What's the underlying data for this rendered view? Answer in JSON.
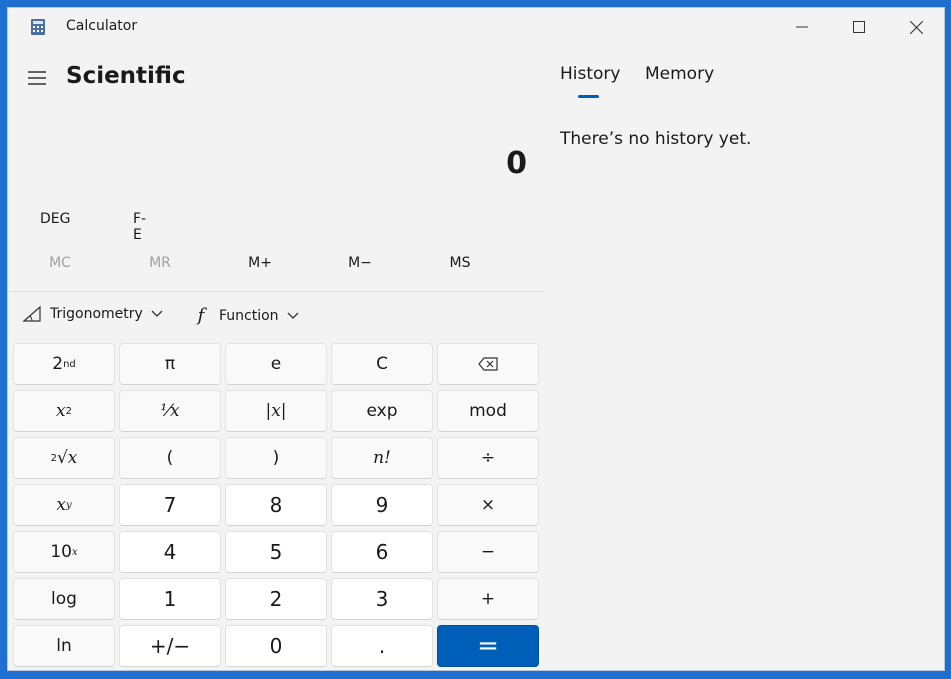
{
  "window": {
    "title": "Calculator",
    "icons": {
      "app": "calculator-icon",
      "minimize": "minimize-icon",
      "maximize": "maximize-icon",
      "close": "close-icon"
    }
  },
  "header": {
    "mode_title": "Scientific",
    "menu_icon": "hamburger-icon"
  },
  "display": {
    "value": "0"
  },
  "modes": {
    "angle": "DEG",
    "notation": "F-E"
  },
  "memory_row": {
    "mc": "MC",
    "mr": "MR",
    "m_plus": "M+",
    "m_minus": "M−",
    "ms": "MS"
  },
  "function_row": {
    "trigonometry": "Trigonometry",
    "function": "Function",
    "function_glyph": "f"
  },
  "keypad": {
    "row1": {
      "second_base": "2",
      "second_sup": "nd",
      "pi": "π",
      "e": "e",
      "clear": "C"
    },
    "row2": {
      "x2_base": "x",
      "x2_sup": "2",
      "reciprocal": "⅟x",
      "abs": "|x|",
      "exp": "exp",
      "mod": "mod"
    },
    "row3": {
      "root_sup": "2",
      "root_body": "√x",
      "open_paren": "(",
      "close_paren": ")",
      "factorial": "n!",
      "divide": "÷"
    },
    "row4": {
      "xy_base": "x",
      "xy_sup": "y",
      "seven": "7",
      "eight": "8",
      "nine": "9",
      "multiply": "×"
    },
    "row5": {
      "tenx_base": "10",
      "tenx_sup": "x",
      "four": "4",
      "five": "5",
      "six": "6",
      "minus": "−"
    },
    "row6": {
      "log": "log",
      "one": "1",
      "two": "2",
      "three": "3",
      "plus": "+"
    },
    "row7": {
      "ln": "ln",
      "negate": "+/−",
      "zero": "0",
      "decimal": ".",
      "equals": "="
    }
  },
  "history_panel": {
    "tabs": {
      "history": "History",
      "memory": "Memory"
    },
    "active_tab": "History",
    "empty_message": "There’s no history yet."
  },
  "colors": {
    "accent": "#005fb8",
    "window_bg": "#f3f3f3",
    "desktop_bg": "#1e6fd0"
  }
}
